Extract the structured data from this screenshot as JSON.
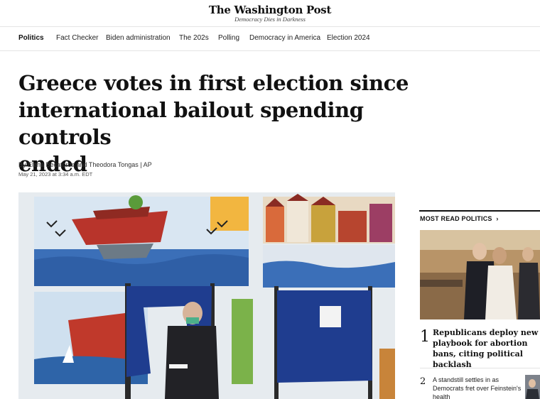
{
  "site": {
    "logo": "The Washington Post",
    "tagline": "Democracy Dies in Darkness"
  },
  "nav": {
    "items": [
      "Politics",
      "Fact Checker",
      "Biden administration",
      "The 202s",
      "Polling",
      "Democracy in America",
      "Election 2024"
    ],
    "active": "Politics"
  },
  "article": {
    "headline_lines": [
      "Greece votes in first election since",
      "international bailout spending controls",
      "ended"
    ],
    "byline": "By Elena Becatoros and Theodora Tongas | AP",
    "date": "May 21, 2023 at 3:34 a.m. EDT"
  },
  "most_read": {
    "title": "MOST READ POLITICS",
    "arrow": "›",
    "items": [
      {
        "rank": "1",
        "title": "Republicans deploy new playbook for abortion bans, citing political backlash"
      },
      {
        "rank": "2",
        "title": "A standstill settles in as Democrats fret over Feinstein's health"
      }
    ]
  },
  "colors": {
    "booth_blue": "#1f3d8f",
    "mural_sea": "#3b6fb8",
    "accent_text": "#111111"
  }
}
